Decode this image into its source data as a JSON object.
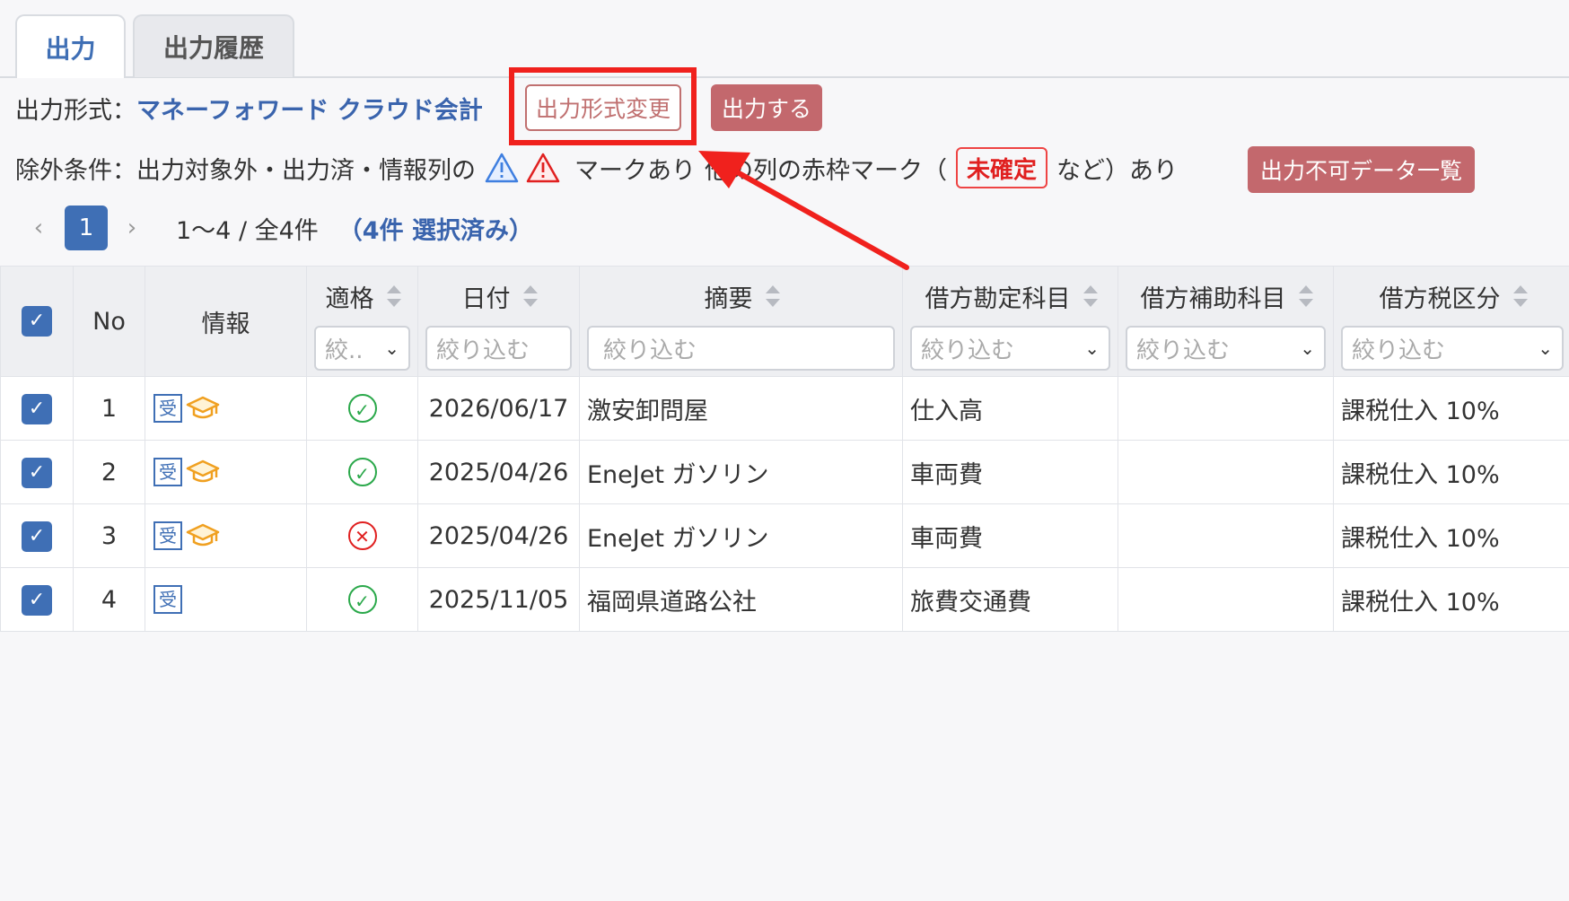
{
  "tabs": [
    {
      "label": "出力",
      "active": true
    },
    {
      "label": "出力履歴",
      "active": false
    }
  ],
  "output_format": {
    "label": "出力形式：",
    "name": "マネーフォワード クラウド会計",
    "change_button": "出力形式変更",
    "output_button": "出力する"
  },
  "exclusion": {
    "label_before": "除外条件：出力対象外・出力済・情報列の",
    "label_mid": "マークあり",
    "label_obscured": "他の列の赤枠マーク（",
    "badge": "未確定",
    "label_after": "など）あり",
    "list_button": "出力不可データ一覧"
  },
  "pagination": {
    "current_page": "1",
    "range": "1〜4 / 全4件",
    "selected": "（4件 選択済み）"
  },
  "table": {
    "columns": [
      {
        "key": "check",
        "label": ""
      },
      {
        "key": "no",
        "label": "No"
      },
      {
        "key": "info",
        "label": "情報"
      },
      {
        "key": "valid",
        "label": "適格",
        "filter": "絞..",
        "dropdown": true
      },
      {
        "key": "date",
        "label": "日付",
        "filter": "絞り込む"
      },
      {
        "key": "summary",
        "label": "摘要",
        "filter": "絞り込む"
      },
      {
        "key": "debit_account",
        "label": "借方勘定科目",
        "filter": "絞り込む",
        "dropdown": true
      },
      {
        "key": "debit_sub",
        "label": "借方補助科目",
        "filter": "絞り込む",
        "dropdown": true
      },
      {
        "key": "debit_tax",
        "label": "借方税区分",
        "filter": "絞り込む",
        "dropdown": true
      }
    ],
    "rows": [
      {
        "no": "1",
        "info_icons": [
          "receipt-icon",
          "graduation-cap-icon"
        ],
        "valid": "ok",
        "date": "2026/06/17",
        "summary": "激安卸問屋",
        "debit_account": "仕入高",
        "debit_sub": "",
        "debit_tax": "課税仕入 10%"
      },
      {
        "no": "2",
        "info_icons": [
          "receipt-icon",
          "graduation-cap-icon"
        ],
        "valid": "ok",
        "date": "2025/04/26",
        "summary": "EneJet ガソリン",
        "debit_account": "車両費",
        "debit_sub": "",
        "debit_tax": "課税仕入 10%"
      },
      {
        "no": "3",
        "info_icons": [
          "receipt-icon",
          "graduation-cap-icon"
        ],
        "valid": "ng",
        "date": "2025/04/26",
        "summary": "EneJet ガソリン",
        "debit_account": "車両費",
        "debit_sub": "",
        "debit_tax": "課税仕入 10%"
      },
      {
        "no": "4",
        "info_icons": [
          "receipt-icon"
        ],
        "valid": "ok",
        "date": "2025/11/05",
        "summary": "福岡県道路公社",
        "debit_account": "旅費交通費",
        "debit_sub": "",
        "debit_tax": "課税仕入 10%"
      }
    ]
  },
  "icons": {
    "receipt_glyph": "受",
    "check_glyph": "✓",
    "ok_glyph": "✓",
    "ng_glyph": "✕",
    "cap_glyph": "🎓"
  },
  "colors": {
    "accent": "#3f6fb5",
    "danger_button": "#c3686d",
    "highlight": "#f0211d"
  }
}
